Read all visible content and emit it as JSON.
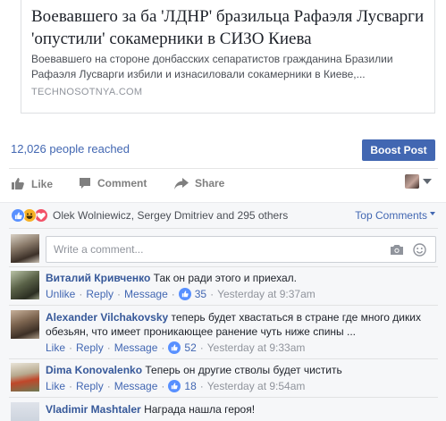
{
  "link_preview": {
    "title": "Воевавшего за ба 'ЛДНР' бразильца Рафаэля Лусварги 'опустили' сокамерники в СИЗО Киева",
    "description": "Воевавшего на стороне донбасских сепаратистов гражданина Бразилии Рафаэля Лусварги избили и изнасиловали сокамерники в Киеве,...",
    "domain": "TECHNOSOTNYA.COM"
  },
  "reach": {
    "text": "12,026 people reached",
    "boost_label": "Boost Post"
  },
  "actions": {
    "like": "Like",
    "comment": "Comment",
    "share": "Share"
  },
  "reactions": {
    "summary": "Olek Wolniewicz, Sergey Dmitriev and 295 others",
    "sort_label": "Top Comments"
  },
  "composer": {
    "placeholder": "Write a comment..."
  },
  "comments": [
    {
      "author": "Виталий Кривченко",
      "text": "Так он ради этого и приехал.",
      "like": "Unlike",
      "reply": "Reply",
      "message": "Message",
      "likes": "35",
      "time": "Yesterday at 9:37am"
    },
    {
      "author": "Alexander Vilchakovsky",
      "text": "теперь будет хвастаться в стране где много диких обезьян, что имеет проникающее ранение чуть ниже спины ...",
      "like": "Like",
      "reply": "Reply",
      "message": "Message",
      "likes": "52",
      "time": "Yesterday at 9:33am"
    },
    {
      "author": "Dima Konovalenko",
      "text": "Теперь он другие стволы будет чистить",
      "like": "Like",
      "reply": "Reply",
      "message": "Message",
      "likes": "18",
      "time": "Yesterday at 9:54am"
    },
    {
      "author": "Vladimir Mashtaler",
      "text": "Награда нашла героя!",
      "like": "",
      "reply": "",
      "message": "",
      "likes": "",
      "time": ""
    }
  ],
  "colors": {
    "fb_blue": "#4267b2",
    "name_blue": "#365899",
    "like_blue": "#5890ff",
    "panel_gray": "#f6f7f9"
  }
}
